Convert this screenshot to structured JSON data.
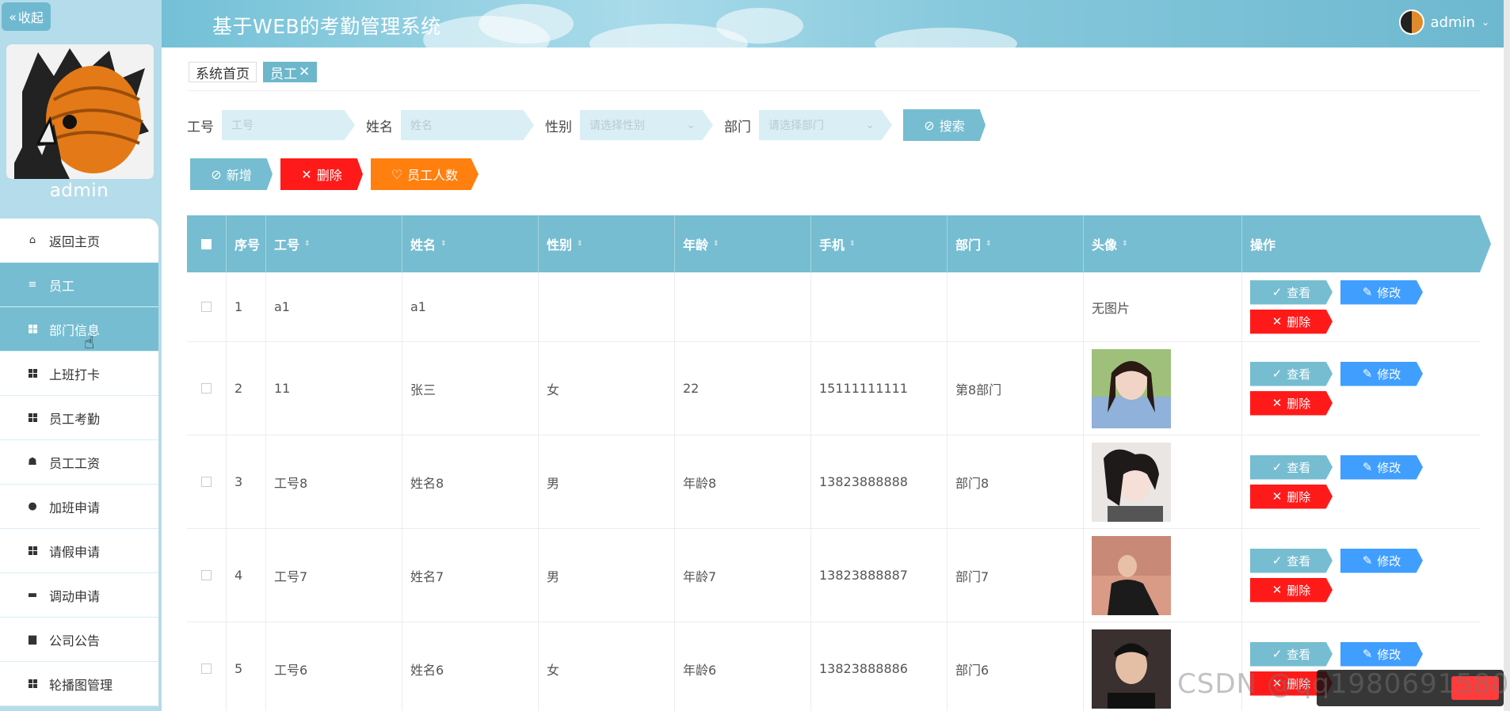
{
  "sidebar": {
    "collapse_label": "收起",
    "username": "admin",
    "items": [
      {
        "label": "返回主页",
        "icon": "home-icon"
      },
      {
        "label": "员工",
        "icon": "list-icon"
      },
      {
        "label": "部门信息",
        "icon": "grid-icon"
      },
      {
        "label": "上班打卡",
        "icon": "grid-icon"
      },
      {
        "label": "员工考勤",
        "icon": "grid-icon"
      },
      {
        "label": "员工工资",
        "icon": "thumb-icon"
      },
      {
        "label": "加班申请",
        "icon": "user-icon"
      },
      {
        "label": "请假申请",
        "icon": "grid-icon"
      },
      {
        "label": "调动申请",
        "icon": "monitor-icon"
      },
      {
        "label": "公司公告",
        "icon": "printer-icon"
      },
      {
        "label": "轮播图管理",
        "icon": "grid-icon"
      }
    ]
  },
  "header": {
    "title": "基于WEB的考勤管理系统",
    "user": "admin"
  },
  "tabs": [
    "系统首页",
    "员工"
  ],
  "filters": {
    "gonghao_label": "工号",
    "gonghao_placeholder": "工号",
    "name_label": "姓名",
    "name_placeholder": "姓名",
    "gender_label": "性别",
    "gender_placeholder": "请选择性别",
    "dept_label": "部门",
    "dept_placeholder": "请选择部门",
    "search_label": "搜索"
  },
  "actions": {
    "add": "新增",
    "delete": "删除",
    "count": "员工人数"
  },
  "table": {
    "headers": [
      "序号",
      "工号",
      "姓名",
      "性别",
      "年龄",
      "手机",
      "部门",
      "头像",
      "操作"
    ],
    "ops": {
      "view": "查看",
      "edit": "修改",
      "delete": "删除"
    },
    "rows": [
      {
        "no": "1",
        "gonghao": "a1",
        "name": "a1",
        "gender": "",
        "age": "",
        "phone": "",
        "dept": "",
        "avatar_text": "无图片"
      },
      {
        "no": "2",
        "gonghao": "11",
        "name": "张三",
        "gender": "女",
        "age": "22",
        "phone": "15111111111",
        "dept": "第8部门",
        "avatar_text": ""
      },
      {
        "no": "3",
        "gonghao": "工号8",
        "name": "姓名8",
        "gender": "男",
        "age": "年龄8",
        "phone": "13823888888",
        "dept": "部门8",
        "avatar_text": ""
      },
      {
        "no": "4",
        "gonghao": "工号7",
        "name": "姓名7",
        "gender": "男",
        "age": "年龄7",
        "phone": "13823888887",
        "dept": "部门7",
        "avatar_text": ""
      },
      {
        "no": "5",
        "gonghao": "工号6",
        "name": "姓名6",
        "gender": "女",
        "age": "年龄6",
        "phone": "13823888886",
        "dept": "部门6",
        "avatar_text": ""
      }
    ]
  },
  "watermark": "CSDN @qq1980691580",
  "colors": {
    "primary": "#76bdd1",
    "danger": "#ff1a1a",
    "warning": "#ff7f0f",
    "edit": "#409eff"
  }
}
